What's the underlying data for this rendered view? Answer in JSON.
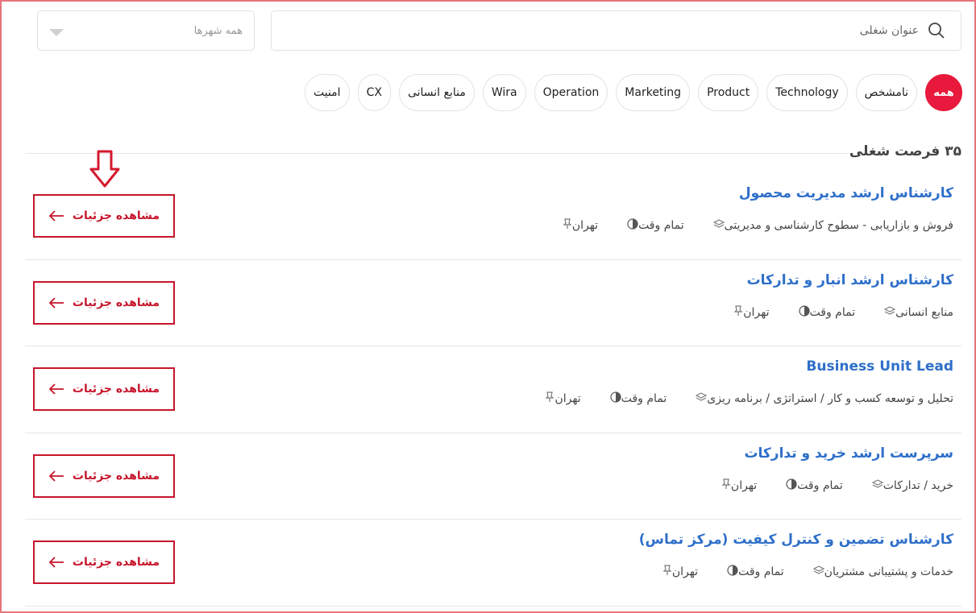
{
  "search": {
    "placeholder": "عنوان شغلی",
    "city_label": "همه شهرها"
  },
  "categories": [
    {
      "label": "همه",
      "active": true
    },
    {
      "label": "نامشخص"
    },
    {
      "label": "Technology"
    },
    {
      "label": "Product"
    },
    {
      "label": "Marketing"
    },
    {
      "label": "Operation"
    },
    {
      "label": "Wira"
    },
    {
      "label": "منابع انسانی"
    },
    {
      "label": "CX"
    },
    {
      "label": "امنیت"
    }
  ],
  "count_text": "۳۵ فرصت شغلی",
  "details_label": "مشاهده جزئیات",
  "jobs": [
    {
      "title": "کارشناس ارشد مدیریت محصول",
      "city": "تهران",
      "type": "تمام وقت",
      "department": "فروش و بازاریابی - سطوح کارشناسی و مدیریتی"
    },
    {
      "title": "کارشناس ارشد انبار و تدارکات",
      "city": "تهران",
      "type": "تمام وقت",
      "department": "منابع انسانی"
    },
    {
      "title": "Business Unit Lead",
      "city": "تهران",
      "type": "تمام وقت",
      "department": "تحلیل و توسعه کسب و کار / استراتژی / برنامه ریزی"
    },
    {
      "title": "سرپرست ارشد خرید و تدارکات",
      "city": "تهران",
      "type": "تمام وقت",
      "department": "خرید / تدارکات"
    },
    {
      "title": "کارشناس تضمین و کنترل کیفیت (مرکز تماس)",
      "city": "تهران",
      "type": "تمام وقت",
      "department": "خدمات و پشتیبانی مشتریان"
    }
  ],
  "colors": {
    "accent": "#e8193c",
    "button": "#c7162b",
    "link": "#2e6fc9"
  }
}
